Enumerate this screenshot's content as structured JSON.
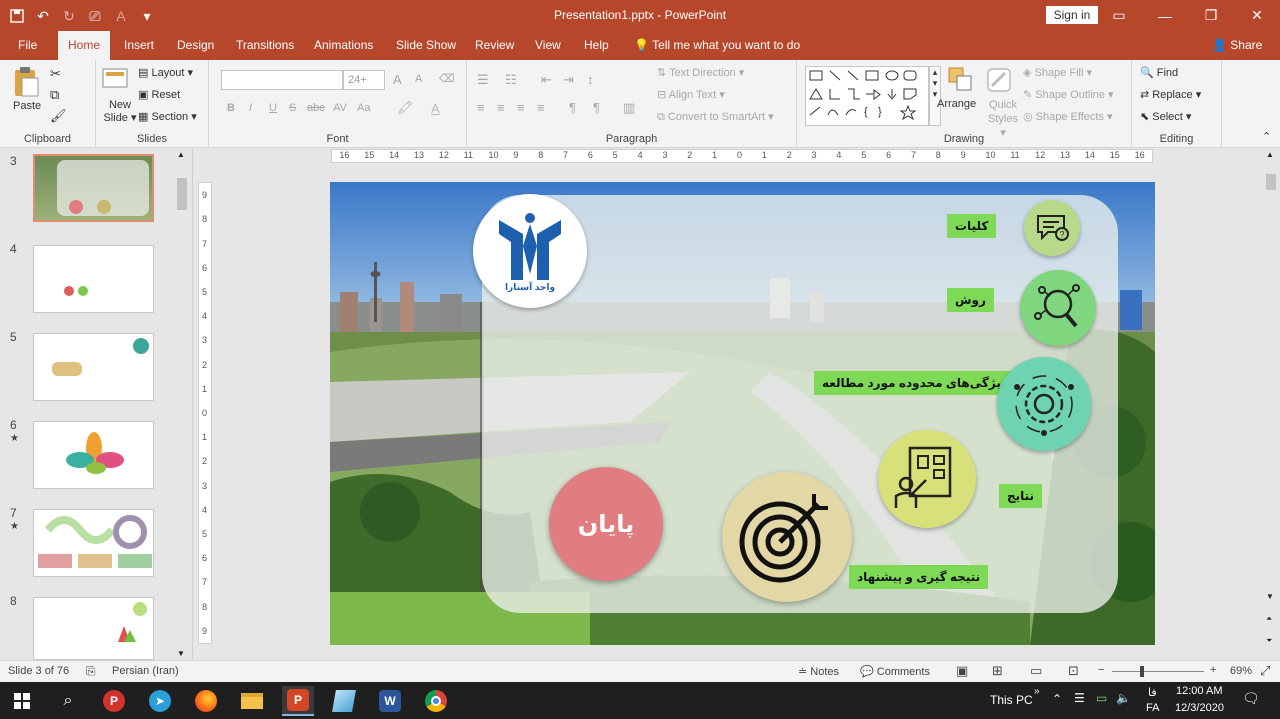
{
  "window": {
    "title": "Presentation1.pptx  -  PowerPoint",
    "sign_in": "Sign in"
  },
  "tabs": [
    {
      "label": "File"
    },
    {
      "label": "Home"
    },
    {
      "label": "Insert"
    },
    {
      "label": "Design"
    },
    {
      "label": "Transitions"
    },
    {
      "label": "Animations"
    },
    {
      "label": "Slide Show"
    },
    {
      "label": "Review"
    },
    {
      "label": "View"
    },
    {
      "label": "Help"
    }
  ],
  "tell_me": "Tell me what you want to do",
  "share": "Share",
  "ribbon": {
    "clipboard": {
      "label": "Clipboard",
      "paste": "Paste"
    },
    "slides": {
      "label": "Slides",
      "new_slide": "New Slide",
      "new_slide_caret": "▾",
      "layout": "Layout ▾",
      "reset": "Reset",
      "section": "Section ▾"
    },
    "font": {
      "label": "Font",
      "size": "24+",
      "bold": "B",
      "italic": "I",
      "underline": "U",
      "strike": "S",
      "abc": "abc",
      "spacing": "AV",
      "case": "Aa",
      "grow": "A",
      "shrink": "A"
    },
    "paragraph": {
      "label": "Paragraph",
      "text_direction": "Text Direction ▾",
      "align_text": "Align Text ▾",
      "convert_smartart": "Convert to SmartArt ▾"
    },
    "drawing": {
      "label": "Drawing",
      "arrange": "Arrange",
      "quick_styles": "Quick Styles ▾",
      "shape_fill": "Shape Fill ▾",
      "shape_outline": "Shape Outline ▾",
      "shape_effects": "Shape Effects ▾"
    },
    "editing": {
      "label": "Editing",
      "find": "Find",
      "replace": "Replace ▾",
      "select": "Select ▾"
    }
  },
  "thumbnails": [
    {
      "num": "3",
      "star": ""
    },
    {
      "num": "4",
      "star": ""
    },
    {
      "num": "5",
      "star": ""
    },
    {
      "num": "6",
      "star": "★"
    },
    {
      "num": "7",
      "star": "★"
    },
    {
      "num": "8",
      "star": ""
    }
  ],
  "ruler": {
    "h_ticks": [
      "16",
      "15",
      "14",
      "13",
      "12",
      "11",
      "10",
      "9",
      "8",
      "7",
      "6",
      "5",
      "4",
      "3",
      "2",
      "1",
      "0",
      "1",
      "2",
      "3",
      "4",
      "5",
      "6",
      "7",
      "8",
      "9",
      "10",
      "11",
      "12",
      "13",
      "14",
      "15",
      "16"
    ],
    "v_ticks": [
      "9",
      "8",
      "7",
      "6",
      "5",
      "4",
      "3",
      "2",
      "1",
      "0",
      "1",
      "2",
      "3",
      "4",
      "5",
      "6",
      "7",
      "8",
      "9"
    ]
  },
  "slide": {
    "logo_text": "واحد آستارا",
    "items": [
      {
        "label": "کلیات",
        "icon": "chat-question-icon",
        "color": "#b8d98a"
      },
      {
        "label": "روش",
        "icon": "magnifier-network-icon",
        "color": "#7fd67f"
      },
      {
        "label": "ویژگی‌های محدوده مورد مطالعه",
        "icon": "gear-network-icon",
        "color": "#6dd3b0"
      },
      {
        "label": "نتایج",
        "icon": "presentation-board-icon",
        "color": "#d8e07a"
      },
      {
        "label": "نتیجه گیری و پیشنهاد",
        "icon": "target-icon",
        "color": "#e3d7a6"
      }
    ],
    "end_button": "پایان",
    "end_color": "#e07d80",
    "accent": "#7ed957"
  },
  "status": {
    "slide_counter": "Slide 3 of 76",
    "language": "Persian (Iran)",
    "notes": "Notes",
    "comments": "Comments",
    "zoom": "69%",
    "zoom_level": 0.69
  },
  "taskbar": {
    "this_pc": "This PC",
    "lang": "FA",
    "lang_short": "فا",
    "time": "12:00 AM",
    "date": "12/3/2020",
    "apps": [
      "start-icon",
      "search-icon",
      "app-p-icon",
      "telegram-icon",
      "firefox-icon",
      "file-explorer-icon",
      "powerpoint-icon",
      "app-blue-icon",
      "word-icon",
      "chrome-icon"
    ]
  }
}
